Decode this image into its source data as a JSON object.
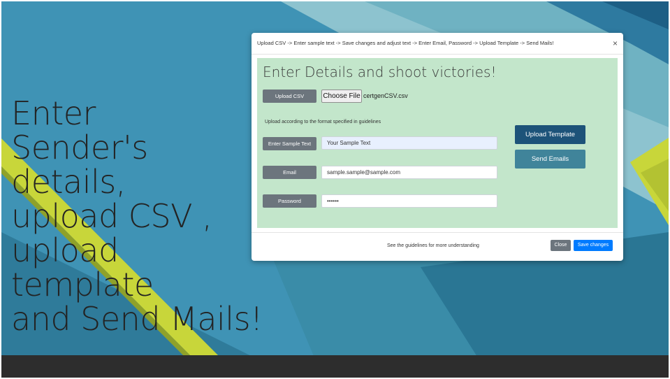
{
  "colors": {
    "background": "#3f93b5",
    "yellow_stripe": "#c8d63a",
    "panel_green": "#c3e6cb",
    "upload_template_btn": "#1d5379",
    "send_emails_btn": "#40849a",
    "save_btn": "#007bff",
    "secondary_btn": "#6c757d"
  },
  "hero": {
    "lines": [
      "Enter",
      "Sender's",
      "details,",
      "upload CSV ,",
      "upload",
      "template",
      "and Send Mails!"
    ]
  },
  "modal": {
    "title": "Upload CSV -> Enter sample text -> Save changes and adjust text -> Enter Email, Password -> Upload Template -> Send Mails!",
    "close_icon": "×",
    "panel_title": "Enter Details and shoot victories!",
    "upload_csv_label": "Upload CSV",
    "choose_file_label": "Choose File",
    "file_name": "certgenCSV.csv",
    "hint": "Upload according to the format specified in guidelines",
    "sample_text_label": "Enter Sample Text",
    "sample_text_value": "Your Sample Text",
    "email_label": "Email",
    "email_value": "sample.sample@sample.com",
    "password_label": "Password",
    "password_value": "••••••",
    "upload_template_label": "Upload Template",
    "send_emails_label": "Send Emails",
    "footer_text": "See the guidelines for more understanding",
    "close_label": "Close",
    "save_label": "Save changes"
  }
}
